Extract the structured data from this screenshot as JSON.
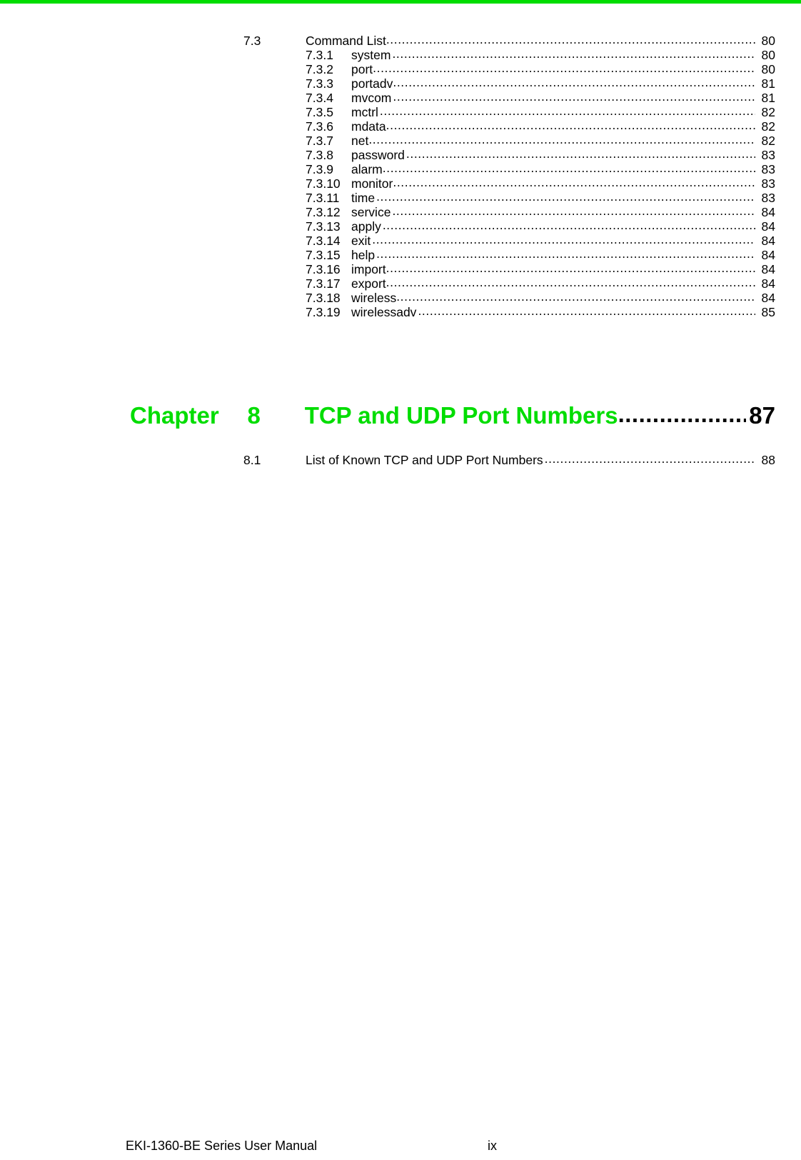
{
  "document": {
    "accent_color": "#00dd00",
    "text_color": "#000000"
  },
  "toc": {
    "section_7_3": {
      "number": "7.3",
      "title": "Command List",
      "page": "80"
    },
    "subsections": [
      {
        "number": "7.3.1",
        "title": "system",
        "page": "80"
      },
      {
        "number": "7.3.2",
        "title": "port",
        "page": "80"
      },
      {
        "number": "7.3.3",
        "title": "portadv",
        "page": "81"
      },
      {
        "number": "7.3.4",
        "title": "mvcom",
        "page": "81"
      },
      {
        "number": "7.3.5",
        "title": "mctrl",
        "page": "82"
      },
      {
        "number": "7.3.6",
        "title": "mdata",
        "page": "82"
      },
      {
        "number": "7.3.7",
        "title": "net",
        "page": "82"
      },
      {
        "number": "7.3.8",
        "title": "password",
        "page": "83"
      },
      {
        "number": "7.3.9",
        "title": "alarm",
        "page": "83"
      },
      {
        "number": "7.3.10",
        "title": "monitor",
        "page": "83"
      },
      {
        "number": "7.3.11",
        "title": "time",
        "page": "83"
      },
      {
        "number": "7.3.12",
        "title": "service",
        "page": "84"
      },
      {
        "number": "7.3.13",
        "title": "apply",
        "page": "84"
      },
      {
        "number": "7.3.14",
        "title": "exit",
        "page": "84"
      },
      {
        "number": "7.3.15",
        "title": "help",
        "page": "84"
      },
      {
        "number": "7.3.16",
        "title": "import",
        "page": "84"
      },
      {
        "number": "7.3.17",
        "title": "export",
        "page": "84"
      },
      {
        "number": "7.3.18",
        "title": "wireless",
        "page": "84"
      },
      {
        "number": "7.3.19",
        "title": "wirelessadv",
        "page": "85"
      }
    ],
    "chapter_8": {
      "label": "Chapter",
      "number": "8",
      "title": "TCP and UDP Port Numbers",
      "page": "87"
    },
    "section_8_1": {
      "number": "8.1",
      "title": "List of Known TCP and UDP Port Numbers",
      "page": "88"
    }
  },
  "footer": {
    "manual_title": "EKI-1360-BE Series User Manual",
    "page_label": "ix"
  }
}
